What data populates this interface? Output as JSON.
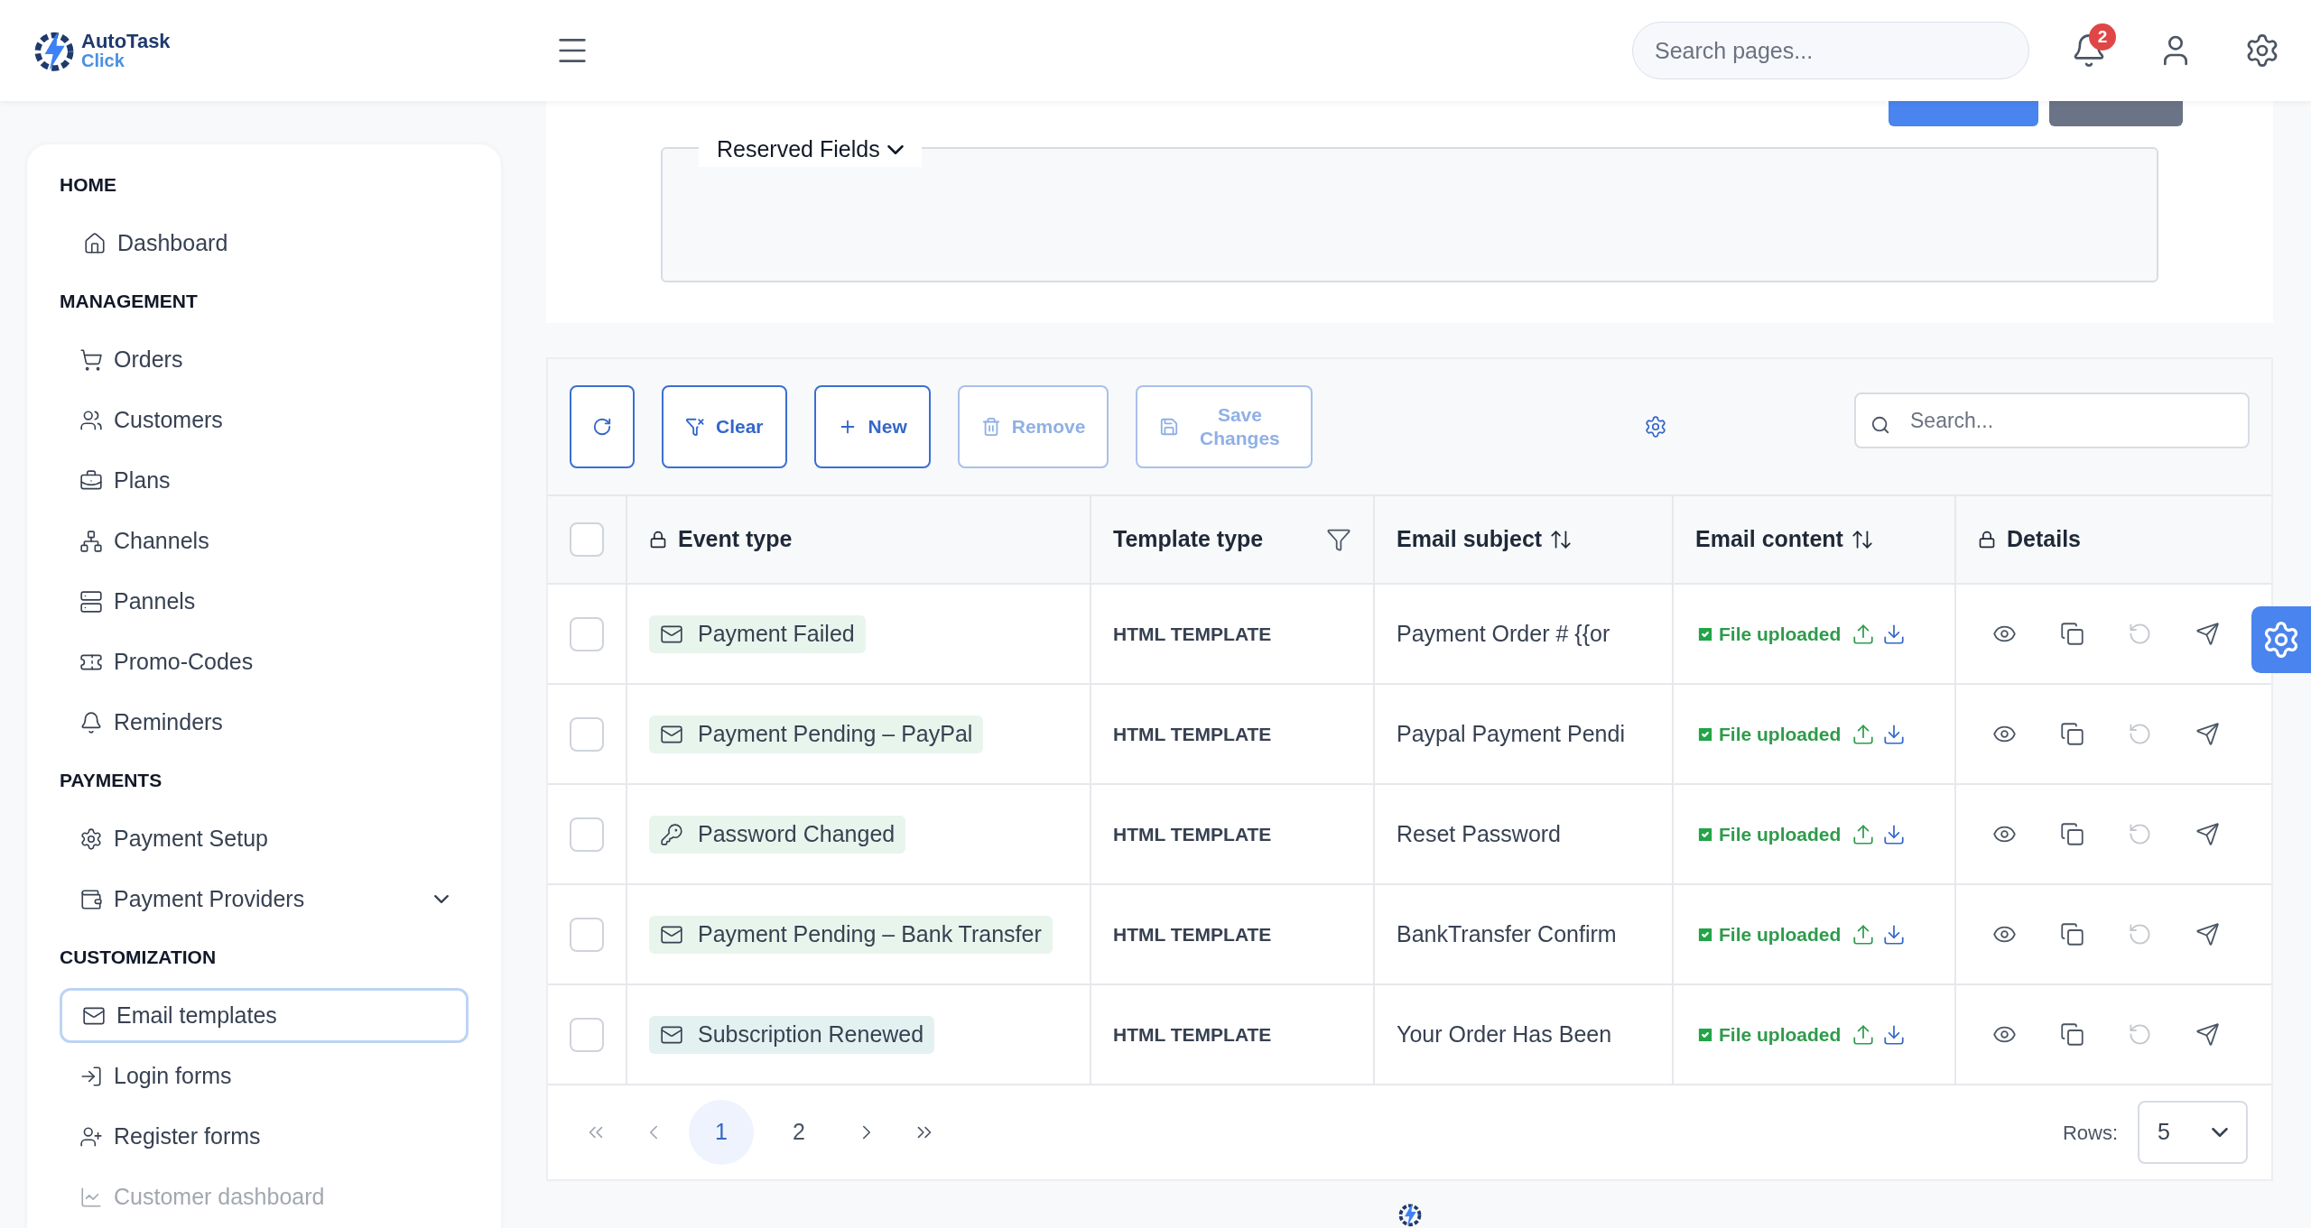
{
  "header": {
    "logo": {
      "line_1": "AutoTask",
      "line_2": "Click"
    },
    "search": {
      "placeholder": "Search pages..."
    },
    "notifications": {
      "count": "2"
    }
  },
  "sidebar": {
    "sections": [
      {
        "title": "HOME",
        "items": [
          {
            "label": "Dashboard",
            "selected": false,
            "disabled": false
          }
        ]
      },
      {
        "title": "MANAGEMENT",
        "items": [
          {
            "label": "Orders",
            "selected": false,
            "disabled": false
          },
          {
            "label": "Customers",
            "selected": false,
            "disabled": false
          },
          {
            "label": "Plans",
            "selected": false,
            "disabled": false
          },
          {
            "label": "Channels",
            "selected": false,
            "disabled": false
          },
          {
            "label": "Pannels",
            "selected": false,
            "disabled": false
          },
          {
            "label": "Promo-Codes",
            "selected": false,
            "disabled": false
          },
          {
            "label": "Reminders",
            "selected": false,
            "disabled": false
          }
        ]
      },
      {
        "title": "PAYMENTS",
        "items": [
          {
            "label": "Payment Setup",
            "selected": false,
            "disabled": false
          },
          {
            "label": "Payment Providers",
            "selected": false,
            "disabled": false,
            "expanded": false
          }
        ]
      },
      {
        "title": "CUSTOMIZATION",
        "items": [
          {
            "label": "Email templates",
            "selected": true,
            "disabled": false
          },
          {
            "label": "Login forms",
            "selected": false,
            "disabled": false
          },
          {
            "label": "Register forms",
            "selected": false,
            "disabled": false
          },
          {
            "label": "Customer dashboard",
            "selected": false,
            "disabled": true
          }
        ]
      }
    ]
  },
  "filter_panel": {
    "reserved_fields": {
      "label": "Reserved Fields",
      "expanded": false
    }
  },
  "toolbar": {
    "buttons": [
      {
        "kind": "refresh",
        "disabled": false
      },
      {
        "kind": "clear",
        "label": "Clear",
        "disabled": false
      },
      {
        "kind": "new",
        "label": "New",
        "disabled": false
      },
      {
        "kind": "remove",
        "label": "Remove",
        "disabled": true
      },
      {
        "kind": "save",
        "label": "Save Changes",
        "disabled": true
      }
    ],
    "search": {
      "placeholder": "Search..."
    }
  },
  "table": {
    "columns": [
      {
        "label": "Event type",
        "locked": true,
        "filterable": false,
        "sortable": false
      },
      {
        "label": "Template type",
        "locked": false,
        "filterable": true,
        "sortable": false
      },
      {
        "label": "Email subject",
        "locked": false,
        "filterable": false,
        "sortable": true
      },
      {
        "label": "Email content",
        "locked": false,
        "filterable": false,
        "sortable": true
      },
      {
        "label": "Details",
        "locked": true,
        "filterable": false,
        "sortable": false
      }
    ],
    "all_checked": false,
    "rows": [
      {
        "checked": false,
        "event_type": "Payment Failed",
        "color": "#e8f5ec",
        "template_type": "HTML TEMPLATE",
        "email_subject": "Payment Order # {{or",
        "email_content": "File uploaded",
        "reset_disabled": true
      },
      {
        "checked": false,
        "event_type": "Payment Pending – PayPal",
        "color": "#e8f5ec",
        "template_type": "HTML TEMPLATE",
        "email_subject": "Paypal Payment Pendi",
        "email_content": "File uploaded",
        "reset_disabled": true
      },
      {
        "checked": false,
        "event_type": "Password Changed",
        "color": "#e8f5ec",
        "template_type": "HTML TEMPLATE",
        "email_subject": "Reset Password",
        "email_content": "File uploaded",
        "reset_disabled": true
      },
      {
        "checked": false,
        "event_type": "Payment Pending – Bank Transfer",
        "color": "#e8f5ec",
        "template_type": "HTML TEMPLATE",
        "email_subject": "BankTransfer Confirm",
        "email_content": "File uploaded",
        "reset_disabled": true
      },
      {
        "checked": false,
        "event_type": "Subscription Renewed",
        "color": "#e3f1f1",
        "template_type": "HTML TEMPLATE",
        "email_subject": "Your Order Has Been",
        "email_content": "File uploaded",
        "reset_disabled": true
      }
    ]
  },
  "pagination": {
    "pages": [
      {
        "label": "1",
        "selected": true
      },
      {
        "label": "2",
        "selected": false
      }
    ],
    "rows_label": "Rows:",
    "rows_value": "5"
  }
}
